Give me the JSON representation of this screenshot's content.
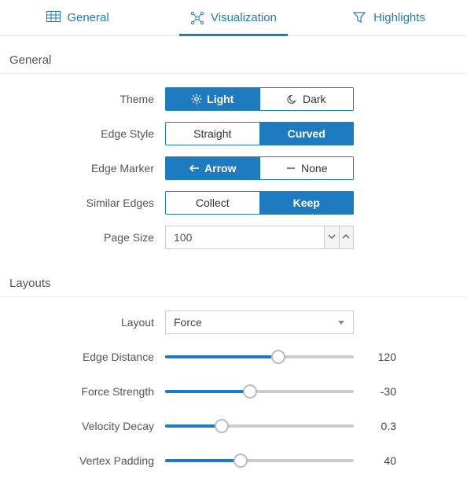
{
  "tabs": {
    "general": "General",
    "visualization": "Visualization",
    "highlights": "Highlights",
    "active": "visualization"
  },
  "sections": {
    "general": "General",
    "layouts": "Layouts"
  },
  "general": {
    "theme": {
      "label": "Theme",
      "light": "Light",
      "dark": "Dark",
      "selected": "light"
    },
    "edge_style": {
      "label": "Edge Style",
      "straight": "Straight",
      "curved": "Curved",
      "selected": "curved"
    },
    "edge_marker": {
      "label": "Edge Marker",
      "arrow": "Arrow",
      "none": "None",
      "selected": "arrow"
    },
    "similar_edges": {
      "label": "Similar Edges",
      "collect": "Collect",
      "keep": "Keep",
      "selected": "keep"
    },
    "page_size": {
      "label": "Page Size",
      "value": "100"
    }
  },
  "layouts": {
    "layout": {
      "label": "Layout",
      "value": "Force"
    },
    "edge_distance": {
      "label": "Edge Distance",
      "value": "120",
      "pct": 60
    },
    "force_strength": {
      "label": "Force Strength",
      "value": "-30",
      "pct": 45
    },
    "velocity_decay": {
      "label": "Velocity Decay",
      "value": "0.3",
      "pct": 30
    },
    "vertex_padding": {
      "label": "Vertex Padding",
      "value": "40",
      "pct": 40
    }
  }
}
